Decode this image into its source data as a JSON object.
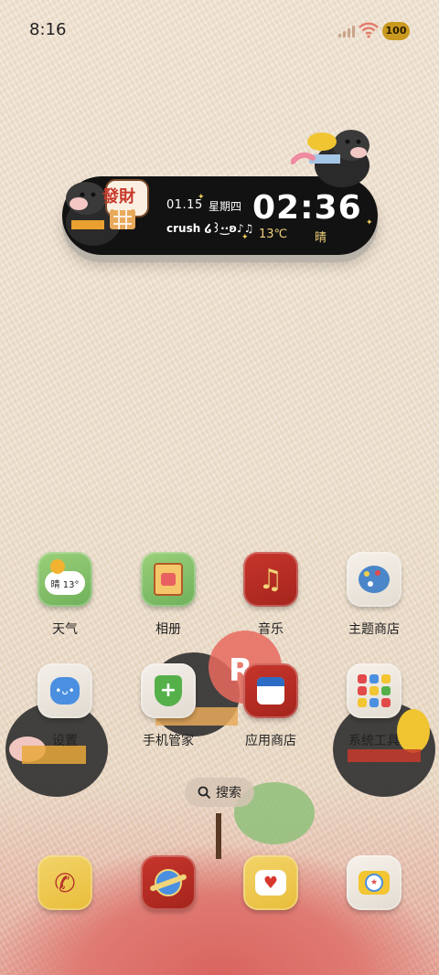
{
  "status_bar": {
    "time": "8:16",
    "battery": "100"
  },
  "widget": {
    "date": "01.15",
    "weekday": "星期四",
    "caption": "crush ໒꒱·͜·ʚ♪♫",
    "clock_hours": "02",
    "clock_minutes": "36",
    "temperature": "13℃",
    "weather": "晴",
    "sign_text": "發財"
  },
  "apps": {
    "row1": [
      {
        "label": "天气",
        "badge": "晴 13°",
        "icon": "weather-icon"
      },
      {
        "label": "相册",
        "icon": "gallery-icon"
      },
      {
        "label": "音乐",
        "icon": "music-icon"
      },
      {
        "label": "主题商店",
        "icon": "theme-store-icon"
      }
    ],
    "row2": [
      {
        "label": "设置",
        "icon": "settings-icon"
      },
      {
        "label": "手机管家",
        "icon": "phone-manager-icon"
      },
      {
        "label": "应用商店",
        "icon": "app-store-icon"
      },
      {
        "label": "系统工具",
        "icon": "system-tools-icon"
      }
    ]
  },
  "search": {
    "label": "搜索"
  },
  "dock": [
    {
      "icon": "phone-icon"
    },
    {
      "icon": "browser-icon"
    },
    {
      "icon": "messages-icon"
    },
    {
      "icon": "camera-icon"
    }
  ],
  "colors": {
    "accent_red": "#c73a2c",
    "accent_yellow": "#f2d57a",
    "widget_bg": "#121212",
    "clock_text": "#ffffff"
  }
}
